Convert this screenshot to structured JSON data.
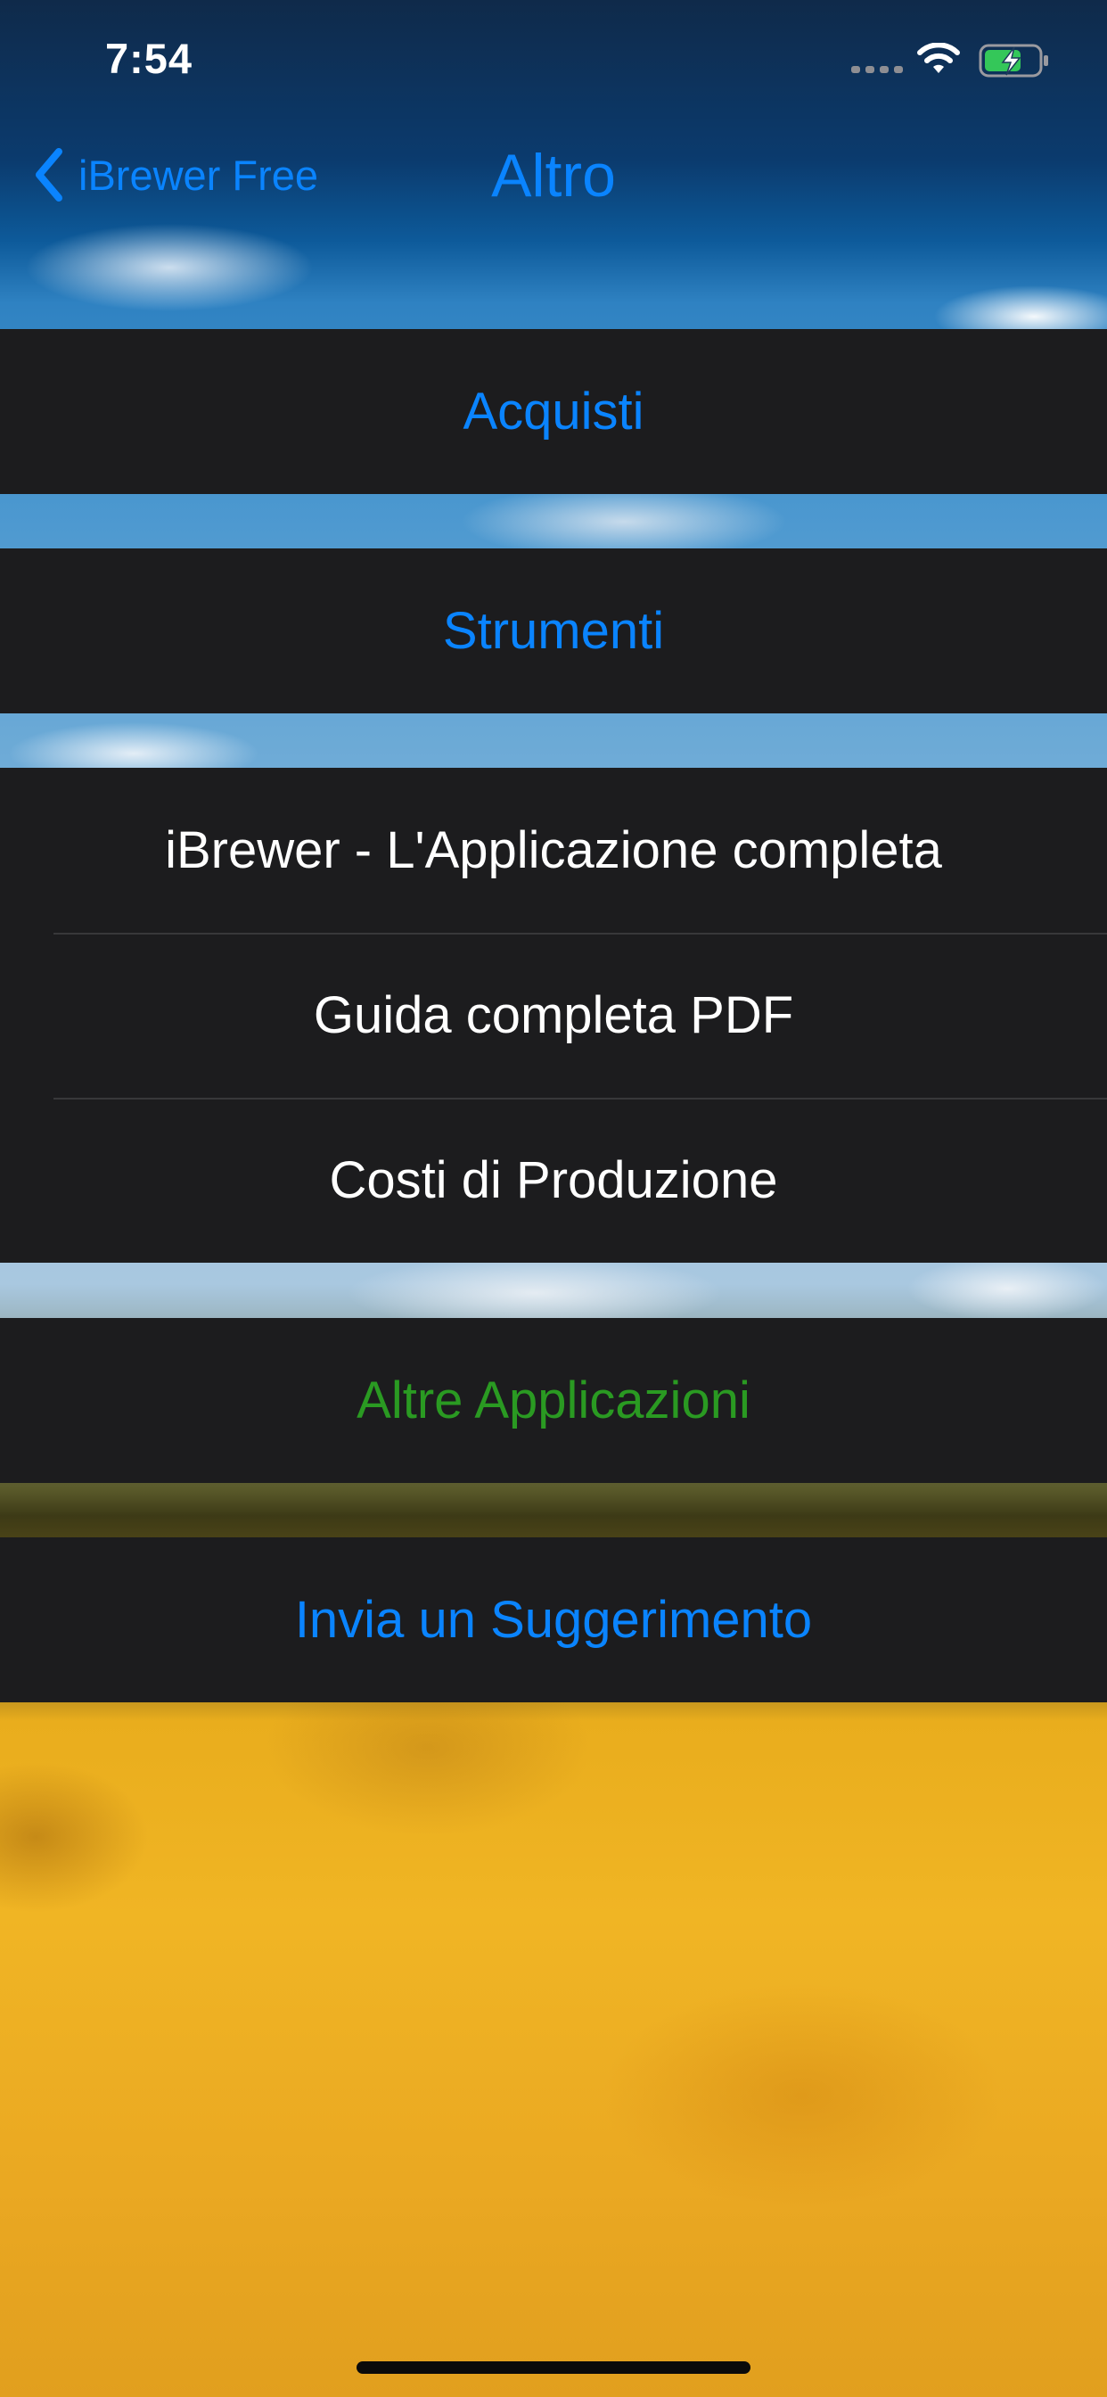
{
  "status_bar": {
    "time": "7:54",
    "icons": [
      "signal-dots-icon",
      "wifi-icon",
      "battery-charging-icon"
    ],
    "battery_color": "#34c759"
  },
  "nav": {
    "back_label": "iBrewer Free",
    "title": "Altro"
  },
  "groups": [
    {
      "items": [
        {
          "label": "Acquisti",
          "color": "blue"
        }
      ]
    },
    {
      "items": [
        {
          "label": "Strumenti",
          "color": "blue"
        }
      ]
    },
    {
      "items": [
        {
          "label": "iBrewer - L'Applicazione completa",
          "color": "white"
        },
        {
          "label": "Guida completa PDF",
          "color": "white"
        },
        {
          "label": "Costi di Produzione",
          "color": "white"
        }
      ]
    },
    {
      "items": [
        {
          "label": "Altre Applicazioni",
          "color": "green"
        }
      ]
    },
    {
      "items": [
        {
          "label": "Invia un Suggerimento",
          "color": "blue"
        }
      ]
    }
  ],
  "colors": {
    "accent": "#0a84ff",
    "green_text": "#2a9a22",
    "cell_background": "#1c1c1e"
  }
}
